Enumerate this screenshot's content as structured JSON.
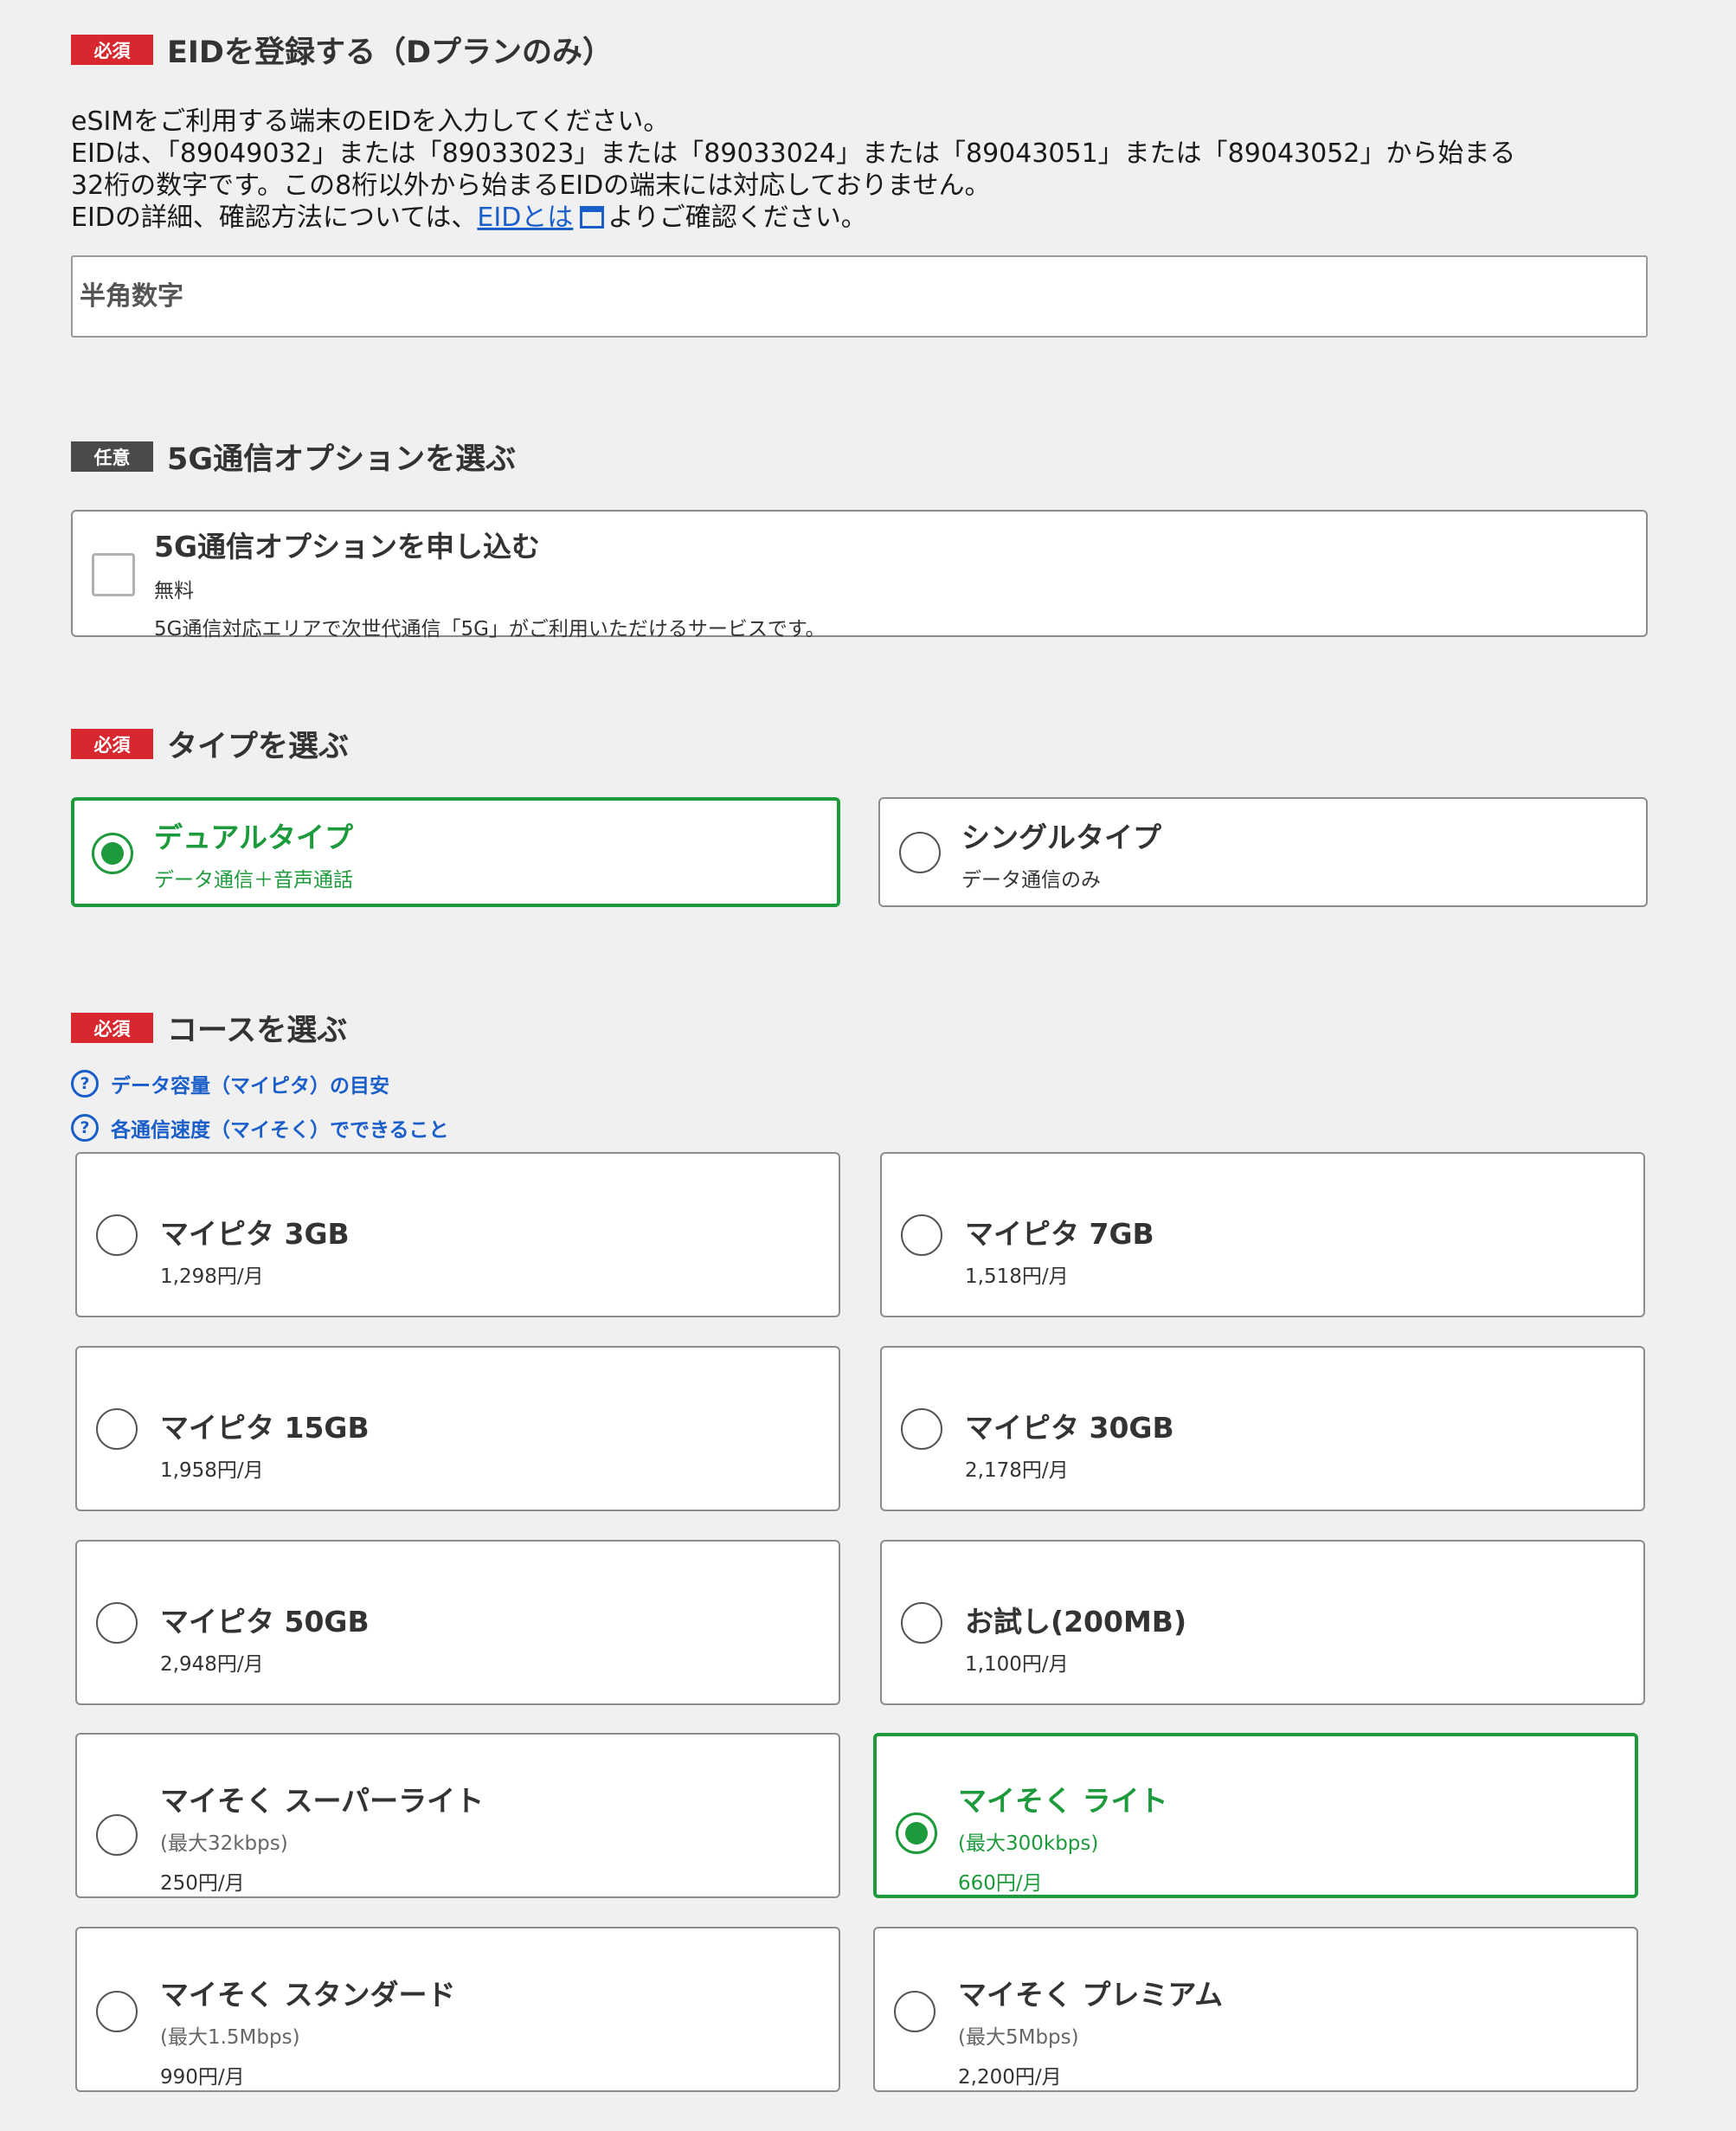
{
  "eid_section": {
    "badge": "必須",
    "title": "EIDを登録する（Dプランのみ）",
    "desc_line1": "eSIMをご利用する端末のEIDを入力してください。",
    "desc_line2": "EIDは、「89049032」または「89033023」または「89033024」または「89043051」または「89043052」から始まる",
    "desc_line3": "32桁の数字です。この8桁以外から始まるEIDの端末には対応しておりません。",
    "desc_line4_before": "EIDの詳細、確認方法については、",
    "desc_link": "EIDとは",
    "desc_line4_after": "よりご確認ください。",
    "input_placeholder": "半角数字",
    "input_value": ""
  },
  "option_5g": {
    "badge": "任意",
    "title": "5G通信オプションを選ぶ",
    "checkbox_title": "5G通信オプションを申し込む",
    "checkbox_price": "無料",
    "checkbox_desc": "5G通信対応エリアで次世代通信「5G」がご利用いただけるサービスです。",
    "checked": false
  },
  "type_section": {
    "badge": "必須",
    "title": "タイプを選ぶ",
    "options": [
      {
        "title": "デュアルタイプ",
        "sub": "データ通信＋音声通話",
        "selected": true
      },
      {
        "title": "シングルタイプ",
        "sub": "データ通信のみ",
        "selected": false
      }
    ]
  },
  "course_section": {
    "badge": "必須",
    "title": "コースを選ぶ",
    "help_links": [
      "データ容量（マイピタ）の目安",
      "各通信速度（マイそく）でできること"
    ],
    "options": [
      {
        "title": "マイピタ 3GB",
        "price": "1,298円/月",
        "selected": false
      },
      {
        "title": "マイピタ 7GB",
        "price": "1,518円/月",
        "selected": false
      },
      {
        "title": "マイピタ 15GB",
        "price": "1,958円/月",
        "selected": false
      },
      {
        "title": "マイピタ 30GB",
        "price": "2,178円/月",
        "selected": false
      },
      {
        "title": "マイピタ 50GB",
        "price": "2,948円/月",
        "selected": false
      },
      {
        "title": "お試し(200MB)",
        "price": "1,100円/月",
        "selected": false
      },
      {
        "title": "マイそく スーパーライト",
        "speed": "(最大32kbps)",
        "price": "250円/月",
        "selected": false
      },
      {
        "title": "マイそく ライト",
        "speed": "(最大300kbps)",
        "price": "660円/月",
        "selected": true
      },
      {
        "title": "マイそく スタンダード",
        "speed": "(最大1.5Mbps)",
        "price": "990円/月",
        "selected": false
      },
      {
        "title": "マイそく プレミアム",
        "speed": "(最大5Mbps)",
        "price": "2,200円/月",
        "selected": false
      }
    ]
  },
  "colors": {
    "required_badge": "#d9272f",
    "optional_badge": "#4a4a4a",
    "selected_green": "#1d9a3c",
    "link_blue": "#1a5ec9",
    "background": "#f0f0f0"
  },
  "icons": [
    "external-link-icon",
    "help-circle-icon",
    "radio-icon",
    "checkbox-icon"
  ]
}
